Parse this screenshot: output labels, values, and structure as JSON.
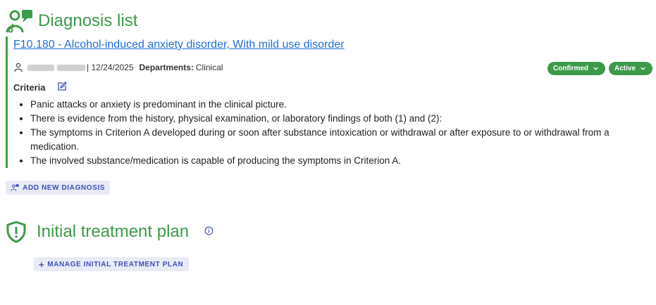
{
  "diagnosis_section": {
    "title": "Diagnosis list",
    "diagnosis": {
      "code_label": "F10.180 - Alcohol-induced anxiety disorder, With mild use disorder",
      "date_text": "| 12/24/2025",
      "departments_label": "Departments:",
      "departments_value": "Clinical",
      "status_pill": "Confirmed",
      "activity_pill": "Active",
      "criteria_label": "Criteria",
      "criteria": [
        "Panic attacks or anxiety is predominant in the clinical picture.",
        "There is evidence from the history, physical examination, or laboratory findings of both (1) and (2):",
        "The symptoms in Criterion A developed during or soon after substance intoxication or withdrawal or after exposure to or withdrawal from a medication.",
        "The involved substance/medication is capable of producing the symptoms in Criterion A."
      ]
    },
    "add_button": "ADD NEW DIAGNOSIS"
  },
  "treatment_section": {
    "title": "Initial treatment plan",
    "manage_button": "MANAGE INITIAL TREATMENT PLAN",
    "manage_button_prefix": "+"
  },
  "colors": {
    "accent_green": "#3c9a4a",
    "link_blue": "#1e6fd9",
    "button_bg": "#e8eaf6",
    "button_text": "#3f51b5"
  },
  "icons": {
    "diagnosis_header": "doctor-chat-icon",
    "user": "user-icon",
    "edit": "edit-icon",
    "chevron": "chevron-down-icon",
    "treatment_header": "shield-alert-icon",
    "info": "info-icon"
  }
}
